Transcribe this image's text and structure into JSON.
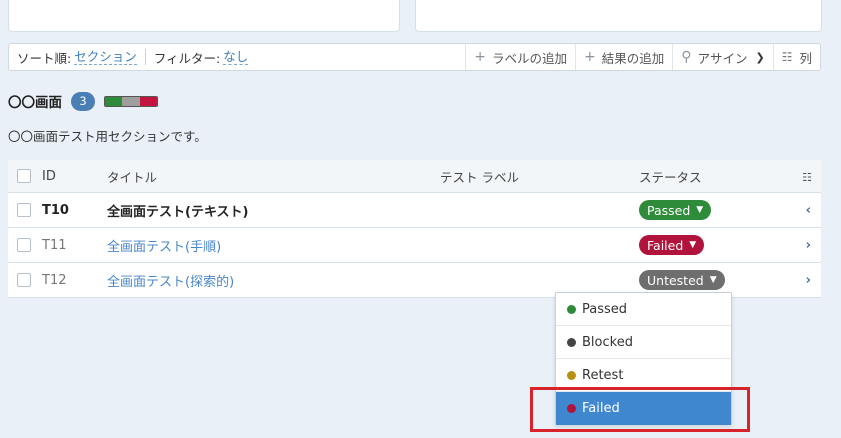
{
  "toolbar": {
    "sort_label": "ソート順:",
    "sort_value": "セクション",
    "filter_label": "フィルター:",
    "filter_value": "なし",
    "add_label": "ラベルの追加",
    "add_result": "結果の追加",
    "assign": "アサイン",
    "columns": "列"
  },
  "section": {
    "title": "〇〇画面",
    "count": "3",
    "description": "〇〇画面テスト用セクションです。",
    "progress": [
      {
        "status": "passed",
        "color": "#2e8b3a",
        "fraction": 0.333
      },
      {
        "status": "untested",
        "color": "#9e9e9e",
        "fraction": 0.333
      },
      {
        "status": "failed",
        "color": "#c2143f",
        "fraction": 0.334
      }
    ]
  },
  "grid": {
    "headers": {
      "id": "ID",
      "title": "タイトル",
      "label": "テスト ラベル",
      "status": "ステータス"
    },
    "rows": [
      {
        "id": "T10",
        "title": "全画面テスト(テキスト)",
        "status": "Passed",
        "chevron": "‹"
      },
      {
        "id": "T11",
        "title": "全画面テスト(手順)",
        "status": "Failed",
        "chevron": "›"
      },
      {
        "id": "T12",
        "title": "全画面テスト(探索的)",
        "status": "Untested",
        "chevron": "›"
      }
    ]
  },
  "status_menu": {
    "options": [
      {
        "label": "Passed",
        "color": "#2e8b3a"
      },
      {
        "label": "Blocked",
        "color": "#444444"
      },
      {
        "label": "Retest",
        "color": "#b8900f"
      },
      {
        "label": "Failed",
        "color": "#b0143c",
        "selected": true
      }
    ]
  },
  "colors": {
    "accent": "#3f87cf",
    "highlight": "#d8232a"
  }
}
